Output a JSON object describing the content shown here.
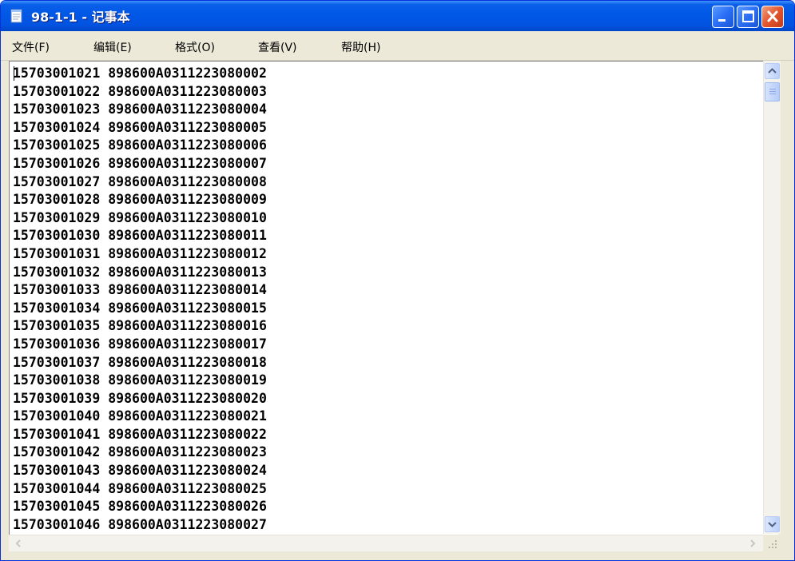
{
  "window": {
    "title": "98-1-1 - 记事本",
    "colors": {
      "titlebar": "#0058e6",
      "close_button": "#e2552d",
      "frame": "#ece9d8"
    }
  },
  "menu": [
    {
      "label": "文件(F)"
    },
    {
      "label": "编辑(E)"
    },
    {
      "label": "格式(O)"
    },
    {
      "label": "查看(V)"
    },
    {
      "label": "帮助(H)"
    }
  ],
  "icons": {
    "app": "notepad-icon",
    "minimize": "minimize-icon",
    "maximize": "maximize-icon",
    "close": "close-icon",
    "scroll_up": "chevron-up-icon",
    "scroll_down": "chevron-down-icon",
    "scroll_left": "chevron-left-icon",
    "scroll_right": "chevron-right-icon",
    "resize_grip": "resize-grip-icon"
  },
  "content": {
    "text": "15703001021 898600A0311223080002\n15703001022 898600A0311223080003\n15703001023 898600A0311223080004\n15703001024 898600A0311223080005\n15703001025 898600A0311223080006\n15703001026 898600A0311223080007\n15703001027 898600A0311223080008\n15703001028 898600A0311223080009\n15703001029 898600A0311223080010\n15703001030 898600A0311223080011\n15703001031 898600A0311223080012\n15703001032 898600A0311223080013\n15703001033 898600A0311223080014\n15703001034 898600A0311223080015\n15703001035 898600A0311223080016\n15703001036 898600A0311223080017\n15703001037 898600A0311223080018\n15703001038 898600A0311223080019\n15703001039 898600A0311223080020\n15703001040 898600A0311223080021\n15703001041 898600A0311223080022\n15703001042 898600A0311223080023\n15703001043 898600A0311223080024\n15703001044 898600A0311223080025\n15703001045 898600A0311223080026\n15703001046 898600A0311223080027"
  }
}
